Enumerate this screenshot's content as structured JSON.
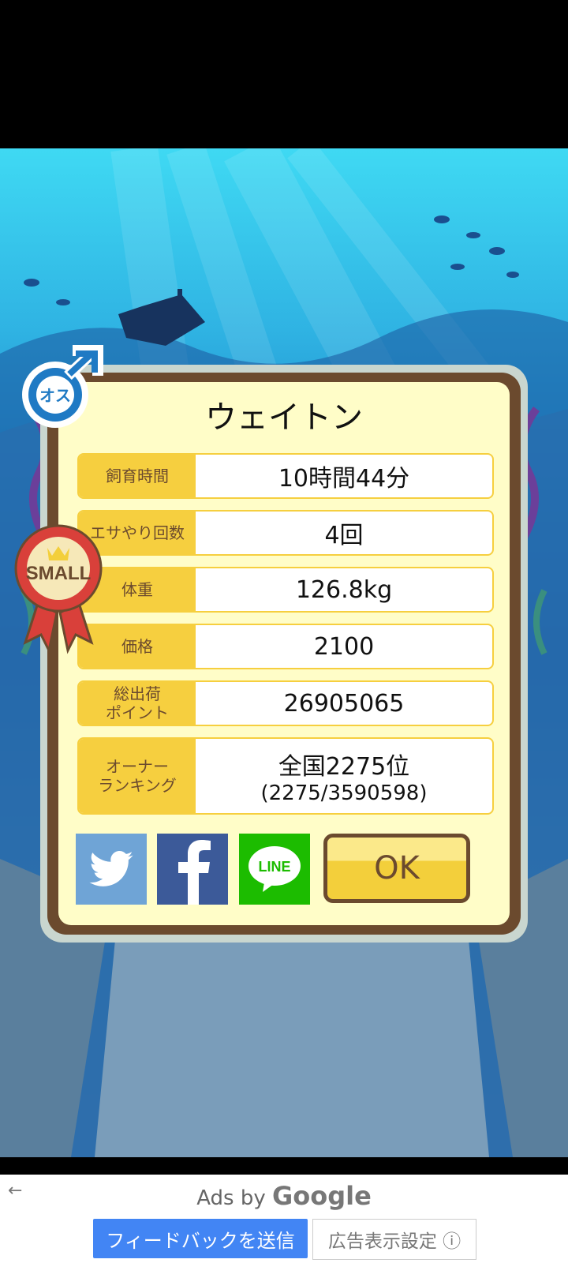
{
  "creature": {
    "name": "ウェイトン",
    "gender_label": "オス",
    "size_badge": "SMALL"
  },
  "stats": [
    {
      "label": "飼育時間",
      "value": "10時間44分"
    },
    {
      "label": "エサやり回数",
      "value": "4回"
    },
    {
      "label": "体重",
      "value": "126.8kg"
    },
    {
      "label": "価格",
      "value": "2100"
    },
    {
      "label": "総出荷\nポイント",
      "value": "26905065"
    }
  ],
  "ranking": {
    "label": "オーナー\nランキング",
    "value": "全国2275位",
    "detail": "(2275/3590598)"
  },
  "buttons": {
    "twitter_icon": "twitter-icon",
    "facebook_icon": "facebook-icon",
    "line_label": "LINE",
    "ok_label": "OK"
  },
  "ad": {
    "ads_by": "Ads by",
    "provider": "Google",
    "feedback_label": "フィードバックを送信",
    "settings_label": "広告表示設定 ⓘ",
    "back_icon": "back-arrow-icon"
  },
  "colors": {
    "card_border": "#6b4a2e",
    "card_bg": "#fffdc8",
    "label_bg": "#f6cf3f",
    "twitter": "#6fa4d6",
    "facebook": "#3c5a99",
    "line": "#1cbc00"
  }
}
